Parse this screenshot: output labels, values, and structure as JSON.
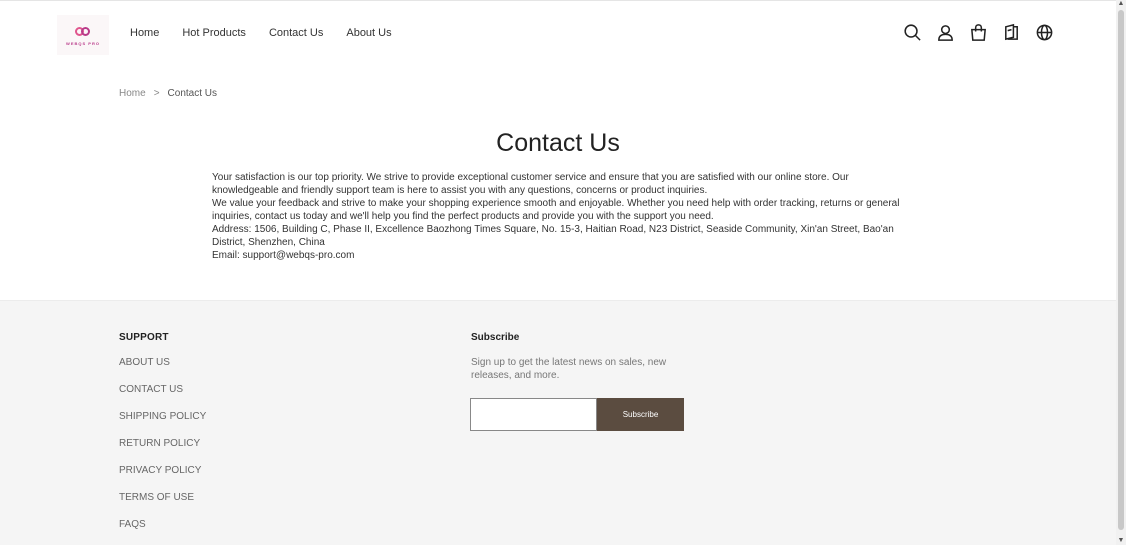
{
  "header": {
    "logo_text": "WEBQS PRO",
    "nav": [
      "Home",
      "Hot Products",
      "Contact Us",
      "About Us"
    ],
    "icons": [
      "search-icon",
      "account-icon",
      "cart-icon",
      "book-icon",
      "globe-icon"
    ]
  },
  "breadcrumb": {
    "home": "Home",
    "separator": ">",
    "current": "Contact Us"
  },
  "main": {
    "title": "Contact Us",
    "paragraphs": [
      "Your satisfaction is our top priority. We strive to provide exceptional customer service and ensure that you are satisfied with our online store. Our knowledgeable and friendly support team is here to assist you with any questions, concerns or product inquiries.",
      "We value your feedback and strive to make your shopping experience smooth and enjoyable. Whether you need help with order tracking, returns or general inquiries, contact us today and we'll help you find the perfect products and provide you with the support you need.",
      "Address: 1506, Building C, Phase II, Excellence Baozhong Times Square, No. 15-3, Haitian Road, N23 District, Seaside Community, Xin'an Street, Bao'an District, Shenzhen, China",
      "Email: support@webqs-pro.com"
    ]
  },
  "footer": {
    "support_title": "SUPPORT",
    "support_links": [
      "ABOUT US",
      "CONTACT US",
      "SHIPPING POLICY",
      "RETURN POLICY",
      "PRIVACY POLICY",
      "TERMS OF USE",
      "FAQS"
    ],
    "subscribe_title": "Subscribe",
    "subscribe_text": "Sign up to get the latest news on sales, new releases, and more.",
    "subscribe_button": "Subscribe",
    "email_value": ""
  },
  "colors": {
    "accent": "#5b4c40",
    "footer_bg": "#f5f5f5"
  }
}
